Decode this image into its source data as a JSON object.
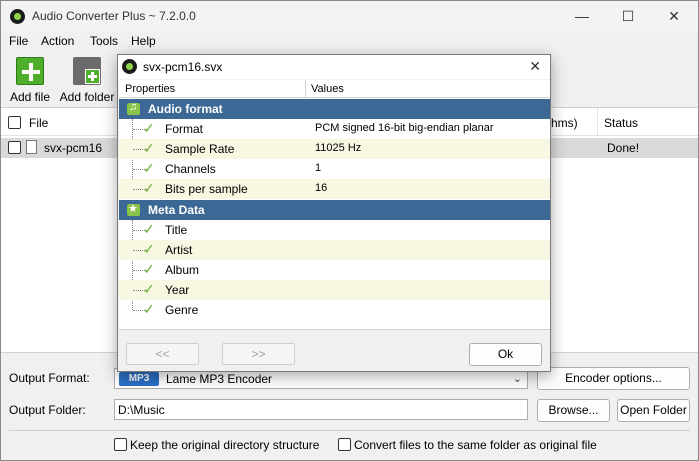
{
  "window": {
    "title": "Audio Converter Plus ~ 7.2.0.0",
    "controls": {
      "minimize": "—",
      "maximize": "☐",
      "close": "✕"
    }
  },
  "menu": [
    "File",
    "Action",
    "Tools",
    "Help"
  ],
  "toolbar": {
    "add_file": "Add file",
    "add_folder": "Add folder"
  },
  "file_list": {
    "columns": {
      "file": "File",
      "duration": "hms)",
      "status": "Status"
    },
    "rows": [
      {
        "name": "svx-pcm16",
        "status": "Done!"
      }
    ]
  },
  "output": {
    "format_label": "Output Format:",
    "format_badge": "MP3",
    "format_value": "Lame MP3 Encoder",
    "encoder_options": "Encoder options...",
    "folder_label": "Output Folder:",
    "folder_value": "D:\\Music",
    "browse": "Browse...",
    "open_folder": "Open Folder",
    "keep_structure": "Keep the original directory structure",
    "same_folder": "Convert files to the same folder as original file"
  },
  "dialog": {
    "title": "svx-pcm16.svx",
    "close": "✕",
    "columns": {
      "properties": "Properties",
      "values": "Values"
    },
    "categories": [
      {
        "name": "Audio format",
        "icon": "music-icon",
        "items": [
          {
            "name": "Format",
            "value": "PCM signed 16-bit big-endian planar"
          },
          {
            "name": "Sample Rate",
            "value": "11025 Hz"
          },
          {
            "name": "Channels",
            "value": "1"
          },
          {
            "name": "Bits per sample",
            "value": "16"
          }
        ]
      },
      {
        "name": "Meta Data",
        "icon": "star-icon",
        "items": [
          {
            "name": "Title",
            "value": ""
          },
          {
            "name": "Artist",
            "value": ""
          },
          {
            "name": "Album",
            "value": ""
          },
          {
            "name": "Year",
            "value": ""
          },
          {
            "name": "Genre",
            "value": ""
          }
        ]
      }
    ],
    "prev": "<<",
    "next": ">>",
    "ok": "Ok"
  }
}
